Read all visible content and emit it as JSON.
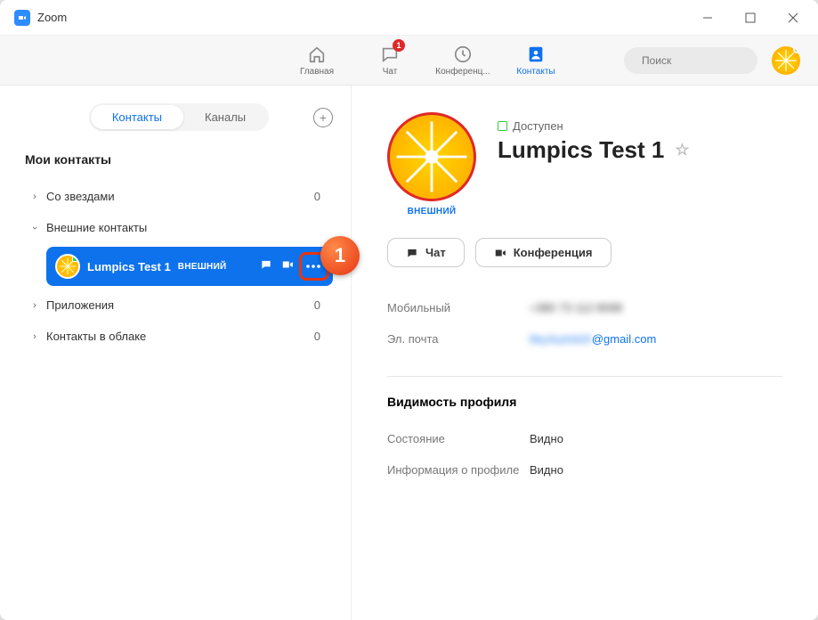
{
  "window": {
    "title": "Zoom"
  },
  "nav": {
    "home": "Главная",
    "chat": "Чат",
    "meetings": "Конференц...",
    "contacts": "Контакты",
    "chat_badge": "1"
  },
  "search": {
    "placeholder": "Поиск"
  },
  "sidebar": {
    "tab_contacts": "Контакты",
    "tab_channels": "Каналы",
    "section_title": "Мои контакты",
    "groups": {
      "starred": {
        "label": "Со звездами",
        "count": "0"
      },
      "external": {
        "label": "Внешние контакты"
      },
      "apps": {
        "label": "Приложения",
        "count": "0"
      },
      "cloud": {
        "label": "Контакты в облаке",
        "count": "0"
      }
    },
    "selected_contact": {
      "name": "Lumpics Test 1",
      "tag": "ВНЕШНИЙ"
    }
  },
  "callout": {
    "number": "1"
  },
  "detail": {
    "status": "Доступен",
    "name": "Lumpics Test 1",
    "avatar_tag": "ВНЕШНИЙ",
    "actions": {
      "chat": "Чат",
      "meeting": "Конференция"
    },
    "mobile_label": "Мобильный",
    "mobile_value": "+380 73 112 8098",
    "email_label": "Эл. почта",
    "email_value_prefix": "iley.kuzmich",
    "email_value_suffix": "@gmail.com",
    "visibility_header": "Видимость профиля",
    "state_label": "Состояние",
    "state_value": "Видно",
    "info_label": "Информация о профиле",
    "info_value": "Видно"
  }
}
